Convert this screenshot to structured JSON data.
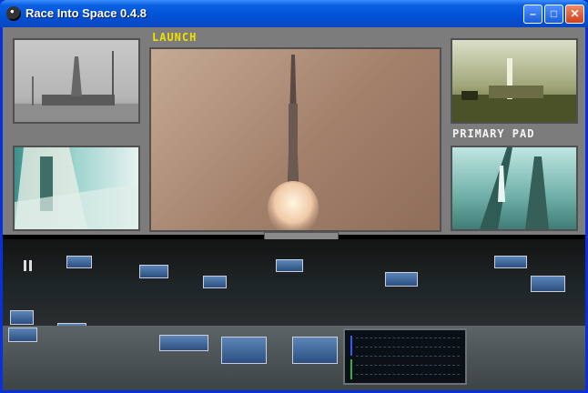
{
  "window": {
    "title": "Race Into Space 0.4.8",
    "controls": {
      "minimize": "–",
      "maximize": "□",
      "close": "✕"
    }
  },
  "screens": {
    "launch_label": "LAUNCH",
    "pad_label": "PRIMARY PAD"
  },
  "icons": {
    "app": "globe-icon",
    "pause": "pause-icon"
  },
  "colors": {
    "launch_label": "#f0e000",
    "pad_label": "#f4f4f4",
    "screen_bg": "#7c7c7c"
  }
}
